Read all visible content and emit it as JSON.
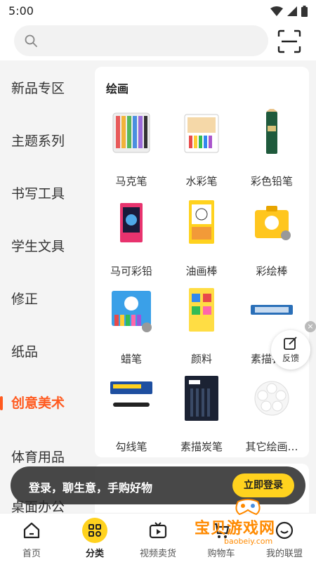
{
  "status": {
    "time": "5:00"
  },
  "search": {
    "placeholder": ""
  },
  "sidebar": {
    "items": [
      {
        "label": "新品专区"
      },
      {
        "label": "主题系列"
      },
      {
        "label": "书写工具"
      },
      {
        "label": "学生文具"
      },
      {
        "label": "修正"
      },
      {
        "label": "纸品"
      },
      {
        "label": "创意美术"
      },
      {
        "label": "体育用品"
      },
      {
        "label": "桌面办公"
      }
    ],
    "active_index": 6
  },
  "panel": {
    "title": "绘画",
    "products": [
      {
        "label": "马克笔"
      },
      {
        "label": "水彩笔"
      },
      {
        "label": "彩色铅笔"
      },
      {
        "label": "马可彩铅"
      },
      {
        "label": "油画棒"
      },
      {
        "label": "彩绘棒"
      },
      {
        "label": "蜡笔"
      },
      {
        "label": "颜料"
      },
      {
        "label": "素描铅笔"
      },
      {
        "label": "勾线笔"
      },
      {
        "label": "素描炭笔"
      },
      {
        "label": "其它绘画…"
      }
    ]
  },
  "feedback": {
    "label": "反馈",
    "close": "×"
  },
  "login_banner": {
    "text": "登录，聊生意，手购好物",
    "button": "立即登录"
  },
  "tabbar": {
    "tabs": [
      {
        "label": "首页"
      },
      {
        "label": "分类"
      },
      {
        "label": "视频卖货"
      },
      {
        "label": "购物车"
      },
      {
        "label": "我的联盟"
      }
    ],
    "active_index": 1
  },
  "watermark": {
    "title": "宝贝游戏网",
    "url": "baobeiy.com"
  },
  "colors": {
    "accent": "#ff5a1f",
    "brand_yellow": "#ffd21e",
    "watermark": "#ff8a00"
  }
}
